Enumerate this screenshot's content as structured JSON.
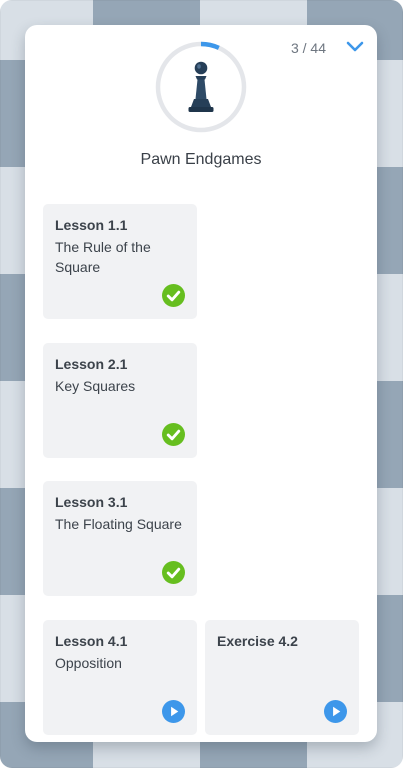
{
  "header": {
    "progress": "3 / 44",
    "progress_fraction": 0.068,
    "collapse_icon": "chevron-down-icon",
    "course_icon": "pawn-icon",
    "course_title": "Pawn Endgames"
  },
  "colors": {
    "accent": "#3d97ea",
    "complete": "#66be1f",
    "ring_track": "#e4e6ea",
    "tile_bg": "#f1f2f4"
  },
  "lessons": [
    {
      "label": "Lesson 1.1",
      "name": "The Rule of the Square",
      "status": "complete",
      "icon": "check-circle-icon"
    },
    {
      "label": "Lesson 2.1",
      "name": "Key Squares",
      "status": "complete",
      "icon": "check-circle-icon"
    },
    {
      "label": "Lesson 3.1",
      "name": "The Floating Square",
      "status": "complete",
      "icon": "check-circle-icon"
    },
    {
      "label": "Lesson 4.1",
      "name": "Opposition",
      "status": "available",
      "icon": "play-circle-icon"
    },
    {
      "label": "Exercise 4.2",
      "name": "",
      "status": "available",
      "icon": "play-circle-icon"
    }
  ]
}
